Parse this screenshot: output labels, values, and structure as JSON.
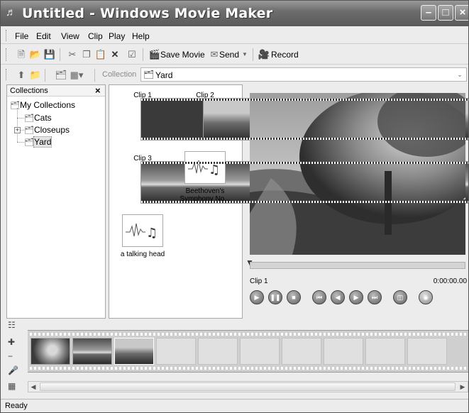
{
  "window": {
    "title": "Untitled - Windows Movie Maker"
  },
  "menu": [
    "File",
    "Edit",
    "View",
    "Clip",
    "Play",
    "Help"
  ],
  "toolbar": {
    "save_movie": "Save Movie",
    "send": "Send",
    "record": "Record"
  },
  "collection_bar": {
    "label": "Collection",
    "value": "Yard"
  },
  "collections_pane": {
    "header": "Collections",
    "tree": [
      "My Collections",
      "Cats",
      "Closeups",
      "Yard"
    ]
  },
  "clips": [
    "Clip 1",
    "Clip 2",
    "Clip 3",
    "Beethoven's Symphony No...",
    "a talking head"
  ],
  "preview": {
    "clip_name": "Clip 1",
    "time": "0:00:00.00"
  },
  "status": {
    "text": "Ready"
  },
  "icons": {
    "app": "movie-maker-icon",
    "minimize": "minimize-icon",
    "maximize": "maximize-icon",
    "close": "close-icon",
    "new": "new-project-icon",
    "open": "open-icon",
    "save": "save-icon",
    "cut": "cut-icon",
    "copy": "copy-icon",
    "paste": "paste-icon",
    "delete": "delete-icon",
    "properties": "properties-icon",
    "up": "up-level-icon",
    "new_collection": "new-collection-icon",
    "collections": "collections-icon",
    "views": "views-icon",
    "play": "play-icon",
    "pause": "pause-icon",
    "stop": "stop-icon",
    "back": "back-icon",
    "prev_frame": "previous-frame-icon",
    "next_frame": "next-frame-icon",
    "forward": "forward-icon",
    "split": "split-icon",
    "snapshot": "snapshot-icon"
  }
}
